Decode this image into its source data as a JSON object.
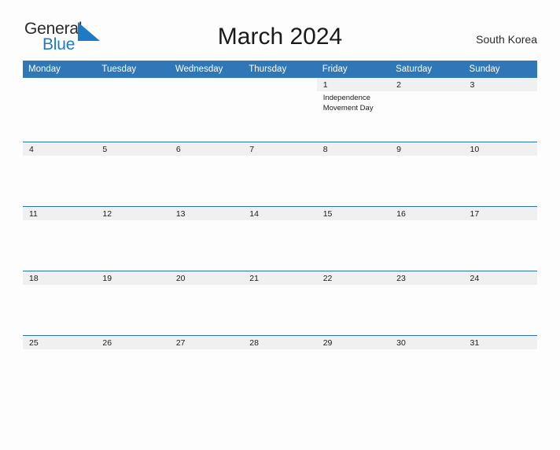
{
  "brand": {
    "name_part1": "General",
    "name_part2": "Blue",
    "flag_color": "#1f7ac4"
  },
  "header": {
    "title": "March 2024",
    "region": "South Korea"
  },
  "theme": {
    "header_blue": "#3077b8",
    "rule_blue": "#2f72b0",
    "band_gray": "#f0f0f0",
    "page_bg": "#fdfdfd",
    "link_blue": "#1f7ac4"
  },
  "calendar": {
    "weekday_headers": [
      "Monday",
      "Tuesday",
      "Wednesday",
      "Thursday",
      "Friday",
      "Saturday",
      "Sunday"
    ],
    "weeks": [
      [
        {
          "day": "",
          "blank": true,
          "events": []
        },
        {
          "day": "",
          "blank": true,
          "events": []
        },
        {
          "day": "",
          "blank": true,
          "events": []
        },
        {
          "day": "",
          "blank": true,
          "events": []
        },
        {
          "day": "1",
          "blank": false,
          "events": [
            "Independence Movement Day"
          ]
        },
        {
          "day": "2",
          "blank": false,
          "events": []
        },
        {
          "day": "3",
          "blank": false,
          "events": []
        }
      ],
      [
        {
          "day": "4",
          "blank": false,
          "events": []
        },
        {
          "day": "5",
          "blank": false,
          "events": []
        },
        {
          "day": "6",
          "blank": false,
          "events": []
        },
        {
          "day": "7",
          "blank": false,
          "events": []
        },
        {
          "day": "8",
          "blank": false,
          "events": []
        },
        {
          "day": "9",
          "blank": false,
          "events": []
        },
        {
          "day": "10",
          "blank": false,
          "events": []
        }
      ],
      [
        {
          "day": "11",
          "blank": false,
          "events": []
        },
        {
          "day": "12",
          "blank": false,
          "events": []
        },
        {
          "day": "13",
          "blank": false,
          "events": []
        },
        {
          "day": "14",
          "blank": false,
          "events": []
        },
        {
          "day": "15",
          "blank": false,
          "events": []
        },
        {
          "day": "16",
          "blank": false,
          "events": []
        },
        {
          "day": "17",
          "blank": false,
          "events": []
        }
      ],
      [
        {
          "day": "18",
          "blank": false,
          "events": []
        },
        {
          "day": "19",
          "blank": false,
          "events": []
        },
        {
          "day": "20",
          "blank": false,
          "events": []
        },
        {
          "day": "21",
          "blank": false,
          "events": []
        },
        {
          "day": "22",
          "blank": false,
          "events": []
        },
        {
          "day": "23",
          "blank": false,
          "events": []
        },
        {
          "day": "24",
          "blank": false,
          "events": []
        }
      ],
      [
        {
          "day": "25",
          "blank": false,
          "events": []
        },
        {
          "day": "26",
          "blank": false,
          "events": []
        },
        {
          "day": "27",
          "blank": false,
          "events": []
        },
        {
          "day": "28",
          "blank": false,
          "events": []
        },
        {
          "day": "29",
          "blank": false,
          "events": []
        },
        {
          "day": "30",
          "blank": false,
          "events": []
        },
        {
          "day": "31",
          "blank": false,
          "events": []
        }
      ]
    ]
  }
}
